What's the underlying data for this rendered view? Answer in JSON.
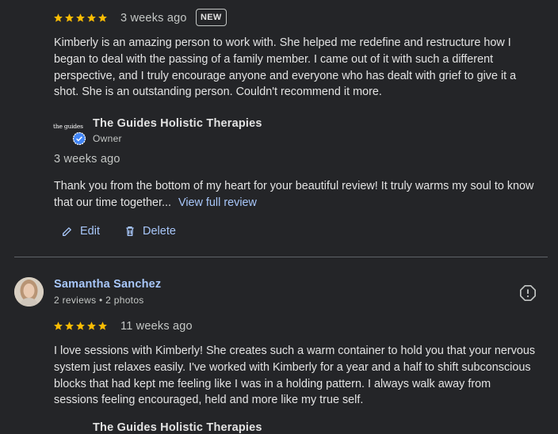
{
  "review1": {
    "rating": 5,
    "date": "3 weeks ago",
    "badge": "NEW",
    "text": "Kimberly is an amazing person to work with. She helped me redefine and restructure how I began to deal with the passing of a family member. I came out of it with such a different perspective, and I truly encourage anyone and everyone who has dealt with grief to give it a shot. She is an outstanding person. Couldn't recommend it more.",
    "owner_reply": {
      "logo_text": "the guides",
      "name": "The Guides Holistic Therapies",
      "role": "Owner",
      "date": "3 weeks ago",
      "text": "Thank you from the bottom of my heart for your beautiful review! It truly warms my soul to know that our time together...",
      "more_link": "View full review"
    },
    "actions": {
      "edit": "Edit",
      "delete": "Delete"
    }
  },
  "review2": {
    "name": "Samantha Sanchez",
    "meta": "2 reviews • 2 photos",
    "rating": 5,
    "date": "11 weeks ago",
    "text": "I love sessions with Kimberly! She creates such a warm container to hold you that your nervous system just relaxes easily. I've worked with Kimberly for a year and a half to shift subconscious blocks that had kept me feeling like I was in a holding pattern. I always walk away from sessions feeling encouraged, held and more like my true self.",
    "owner_reply_name_partial": "The Guides Holistic Therapies"
  },
  "colors": {
    "star": "#fbbc04",
    "link": "#a8c7fa",
    "background": "#242528",
    "verified": "#4285f4"
  },
  "icons": [
    "star-icon",
    "verified-badge-icon",
    "pencil-icon",
    "trash-icon",
    "report-icon"
  ]
}
